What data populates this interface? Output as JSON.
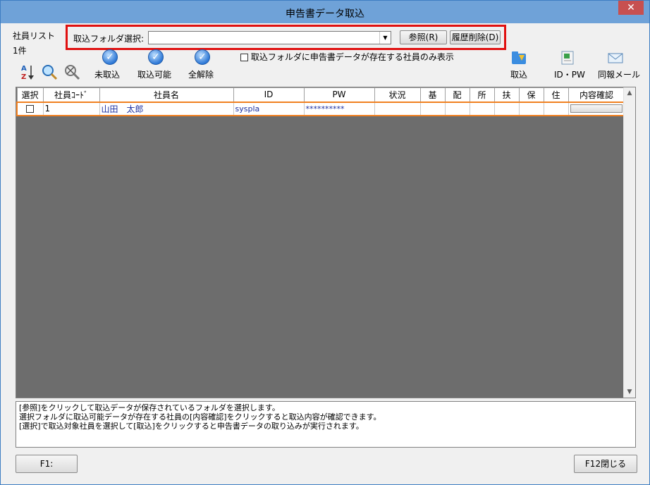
{
  "window": {
    "title": "申告書データ取込",
    "close_glyph": "✕"
  },
  "employee_list": {
    "label": "社員リスト",
    "count": "1件"
  },
  "folder": {
    "label": "取込フォルダ選択:",
    "value": "",
    "browse_label": "参照(R)",
    "clear_history_label": "履歴削除(D)"
  },
  "filter": {
    "label": "取込フォルダに申告書データが存在する社員のみ表示",
    "checked": false
  },
  "toolbar": {
    "sort_icon": "sort-az-icon",
    "search_icon": "search-icon",
    "clear_search_icon": "clear-search-icon",
    "not_imported_label": "未取込",
    "importable_label": "取込可能",
    "clear_all_label": "全解除",
    "import_label": "取込",
    "idpw_label": "ID・PW",
    "mail_label": "同報メール"
  },
  "grid": {
    "columns": [
      "選択",
      "社員ｺｰﾄﾞ",
      "社員名",
      "ID",
      "PW",
      "状況",
      "基",
      "配",
      "所",
      "扶",
      "保",
      "住",
      "内容確認"
    ],
    "rows": [
      {
        "code": "1",
        "name": "山田　太郎",
        "id": "syspla",
        "pw": "**********",
        "status": "",
        "selected": false
      }
    ]
  },
  "help": {
    "lines": [
      "[参照]をクリックして取込データが保存されているフォルダを選択します。",
      "選択フォルダに取込可能データが存在する社員の[内容確認]をクリックすると取込内容が確認できます。",
      "[選択]で取込対象社員を選択して[取込]をクリックすると申告書データの取り込みが実行されます。"
    ]
  },
  "footer": {
    "f1_label": "F1:",
    "f12_label": "F12閉じる"
  },
  "colors": {
    "accent_red": "#e01010",
    "row_highlight": "#f08020",
    "grid_bg": "#6d6d6d",
    "titlebar": "#6fa2d8",
    "close": "#c75050"
  }
}
